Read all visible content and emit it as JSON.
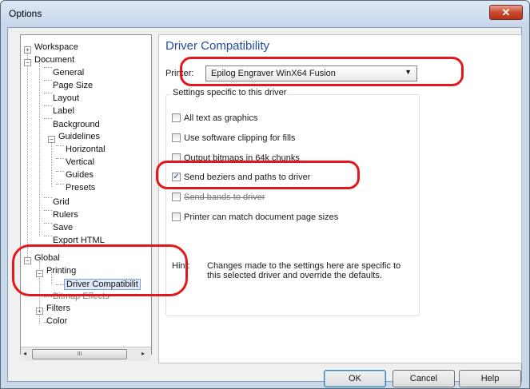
{
  "window": {
    "title": "Options"
  },
  "tree": {
    "workspace": "Workspace",
    "document": "Document",
    "general": "General",
    "page_size": "Page Size",
    "layout": "Layout",
    "label": "Label",
    "background": "Background",
    "guidelines": "Guidelines",
    "horizontal": "Horizontal",
    "vertical": "Vertical",
    "guides": "Guides",
    "presets": "Presets",
    "grid": "Grid",
    "rulers": "Rulers",
    "save": "Save",
    "export_html": "Export HTML",
    "global": "Global",
    "printing": "Printing",
    "driver_compat": "Driver Compatibilit",
    "bitmap_effects": "Bitmap Effects",
    "filters": "Filters",
    "color": "Color"
  },
  "scrollbar": {
    "thumb_grip": "III"
  },
  "panel": {
    "heading": "Driver Compatibility",
    "printer_label": "Printer:",
    "printer_value": "Epilog Engraver WinX64 Fusion",
    "group_title": "Settings specific to this driver",
    "options": [
      {
        "label": "All text as graphics",
        "checked": false
      },
      {
        "label": "Use software clipping for fills",
        "checked": false
      },
      {
        "label": "Output bitmaps in 64k chunks",
        "checked": false
      },
      {
        "label": "Send beziers and paths to driver",
        "checked": true
      },
      {
        "label": "Send bands to driver",
        "checked": false
      },
      {
        "label": "Printer can match document page sizes",
        "checked": false
      }
    ],
    "hint_label": "Hint:",
    "hint_text": "Changes made to the settings here are specific to this selected driver and override the defaults."
  },
  "buttons": {
    "ok": "OK",
    "cancel": "Cancel",
    "help": "Help"
  },
  "colors": {
    "highlight": "#e4181c",
    "heading": "#1f4e99",
    "frame": "#c9d9ec"
  }
}
